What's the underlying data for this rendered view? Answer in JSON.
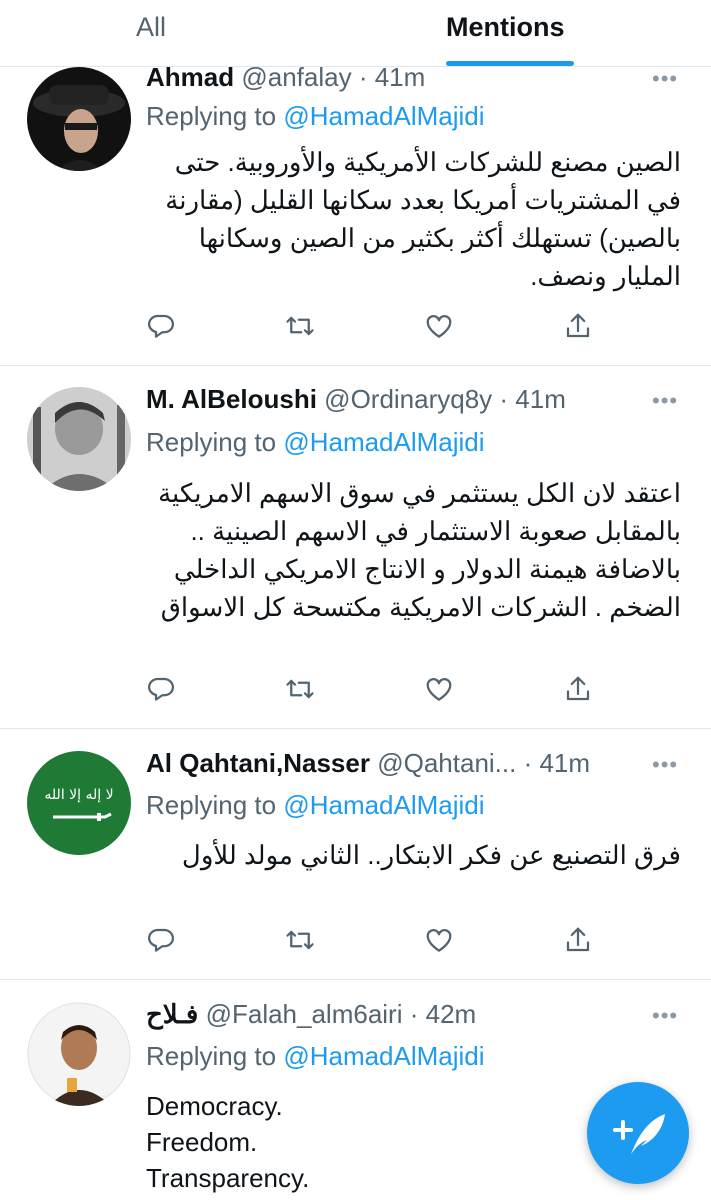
{
  "tabs": {
    "all": "All",
    "mentions": "Mentions"
  },
  "tweets": [
    {
      "name": "Ahmad",
      "handle": "@anfalay",
      "time": "· 41m",
      "reply_prefix": "Replying to",
      "reply_to": "@HamadAlMajidi",
      "text": "الصين مصنع للشركات الأمريكية والأوروبية. حتى في المشتريات أمريكا بعدد سكانها القليل (مقارنة بالصين) تستهلك أكثر بكثير من الصين وسكانها المليار ونصف.",
      "more": "•••"
    },
    {
      "name": "M. AlBeloushi",
      "handle": "@Ordinaryq8y",
      "time": "· 41m",
      "reply_prefix": "Replying to",
      "reply_to": "@HamadAlMajidi",
      "text": "اعتقد لان الكل يستثمر في سوق الاسهم الامريكية بالمقابل صعوبة الاستثمار في الاسهم الصينية .. بالاضافة هيمنة الدولار و الانتاج الامريكي الداخلي الضخم . الشركات الامريكية مكتسحة كل الاسواق",
      "more": "•••"
    },
    {
      "name": "Al Qahtani,Nasser",
      "handle": "@Qahtani...",
      "time": "· 41m",
      "reply_prefix": "Replying to",
      "reply_to": "@HamadAlMajidi",
      "text": "فرق التصنيع  عن فكر الابتكار.. الثاني مولد للأول",
      "more": "•••"
    },
    {
      "name": "فـلاح",
      "handle": "@Falah_alm6airi",
      "time": "· 42m",
      "reply_prefix": "Replying to",
      "reply_to": "@HamadAlMajidi",
      "lines": [
        "Democracy.",
        "Freedom.",
        "Transparency."
      ],
      "more": "•••"
    }
  ],
  "icons": {
    "reply": "reply-icon",
    "retweet": "retweet-icon",
    "like": "like-icon",
    "share": "share-icon",
    "compose": "compose-tweet-icon"
  },
  "colors": {
    "accent": "#1d9bf0",
    "text": "#0f1419",
    "secondary": "#536471",
    "divider": "#e1e8ed"
  }
}
